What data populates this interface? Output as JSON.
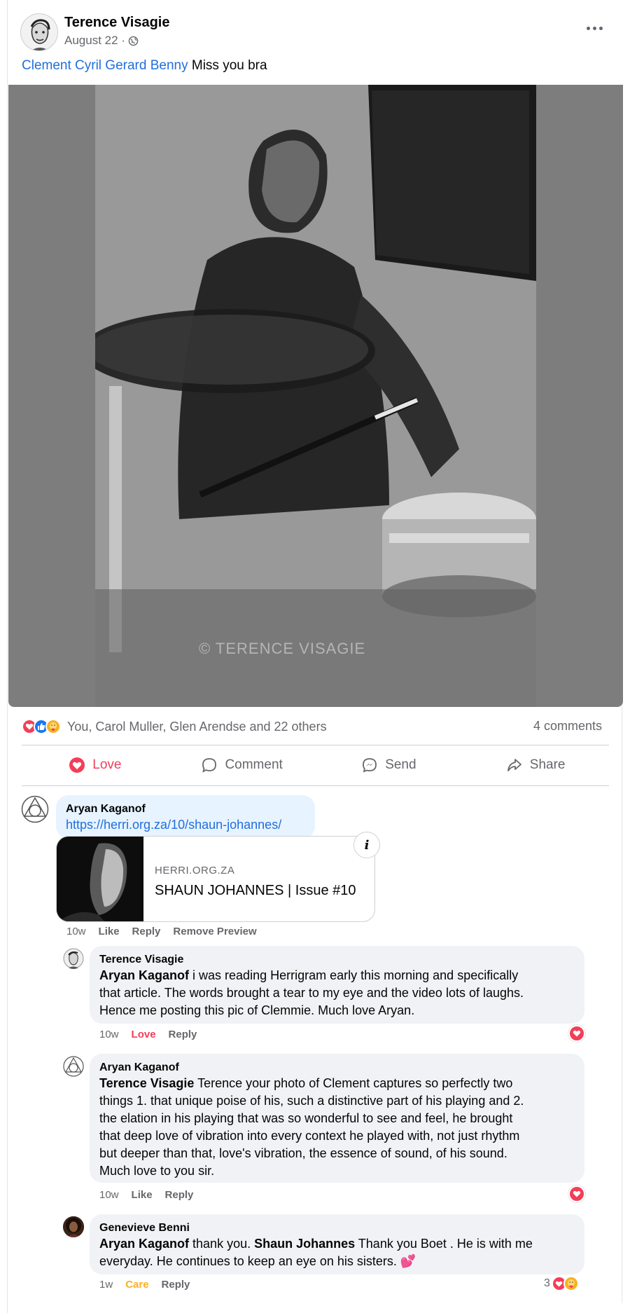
{
  "post": {
    "author": "Terence Visagie",
    "date": "August 22 ·",
    "tagged_name": "Clement Cyril Gerard Benny",
    "text": " Miss you bra",
    "watermark": "© TERENCE VISAGIE"
  },
  "summary": {
    "reactors": "You, Carol Muller, Glen Arendse and 22 others",
    "comments_count": "4 comments",
    "reaction_icons": [
      "love-icon",
      "like-icon",
      "care-icon"
    ]
  },
  "actions": {
    "love": "Love",
    "comment": "Comment",
    "send": "Send",
    "share": "Share"
  },
  "comments": [
    {
      "author": "Aryan Kaganof",
      "link": "https://herri.org.za/10/shaun-johannes/",
      "preview": {
        "domain": "HERRI.ORG.ZA",
        "title": "SHAUN JOHANNES | Issue #10"
      },
      "time": "10w",
      "like": "Like",
      "reply": "Reply",
      "remove_preview": "Remove Preview"
    },
    {
      "author": "Terence Visagie",
      "mention": "Aryan Kaganof",
      "text": " i was reading Herrigram early this morning and specifically",
      "line2": "that article. The words brought a tear to my eye and the video lots of laughs.",
      "line3": "Hence me posting this pic of Clemmie. Much love Aryan.",
      "time": "10w",
      "reaction": "Love",
      "reply": "Reply"
    },
    {
      "author": "Aryan Kaganof",
      "mention": "Terence Visagie",
      "text": " Terence your photo of Clement captures so perfectly two",
      "line2": "things 1. that unique poise of his, such a distinctive part of his playing and 2.",
      "line3": "the elation in his playing that was so wonderful to see and feel, he brought",
      "line4": "that deep love of vibration into every context he played with, not just rhythm",
      "line5": "but deeper than that, love's vibration, the essence of sound, of his sound.",
      "line6": "Much love to you sir.",
      "time": "10w",
      "like": "Like",
      "reply": "Reply"
    },
    {
      "author": "Genevieve Benni",
      "mention1": "Aryan Kaganof",
      "text1": " thank you. ",
      "mention2": "Shaun Johannes",
      "text2": " Thank you Boet . He is with me",
      "line2": "everyday. He continues to keep an eye on his sisters. 💕",
      "time": "1w",
      "reaction": "Care",
      "reply": "Reply",
      "reaction_count": "3"
    }
  ],
  "colors": {
    "link": "#216fdb",
    "love": "#f33e58",
    "care": "#f7b125",
    "secondary_text": "#65676b",
    "bubble": "#f0f2f5"
  }
}
